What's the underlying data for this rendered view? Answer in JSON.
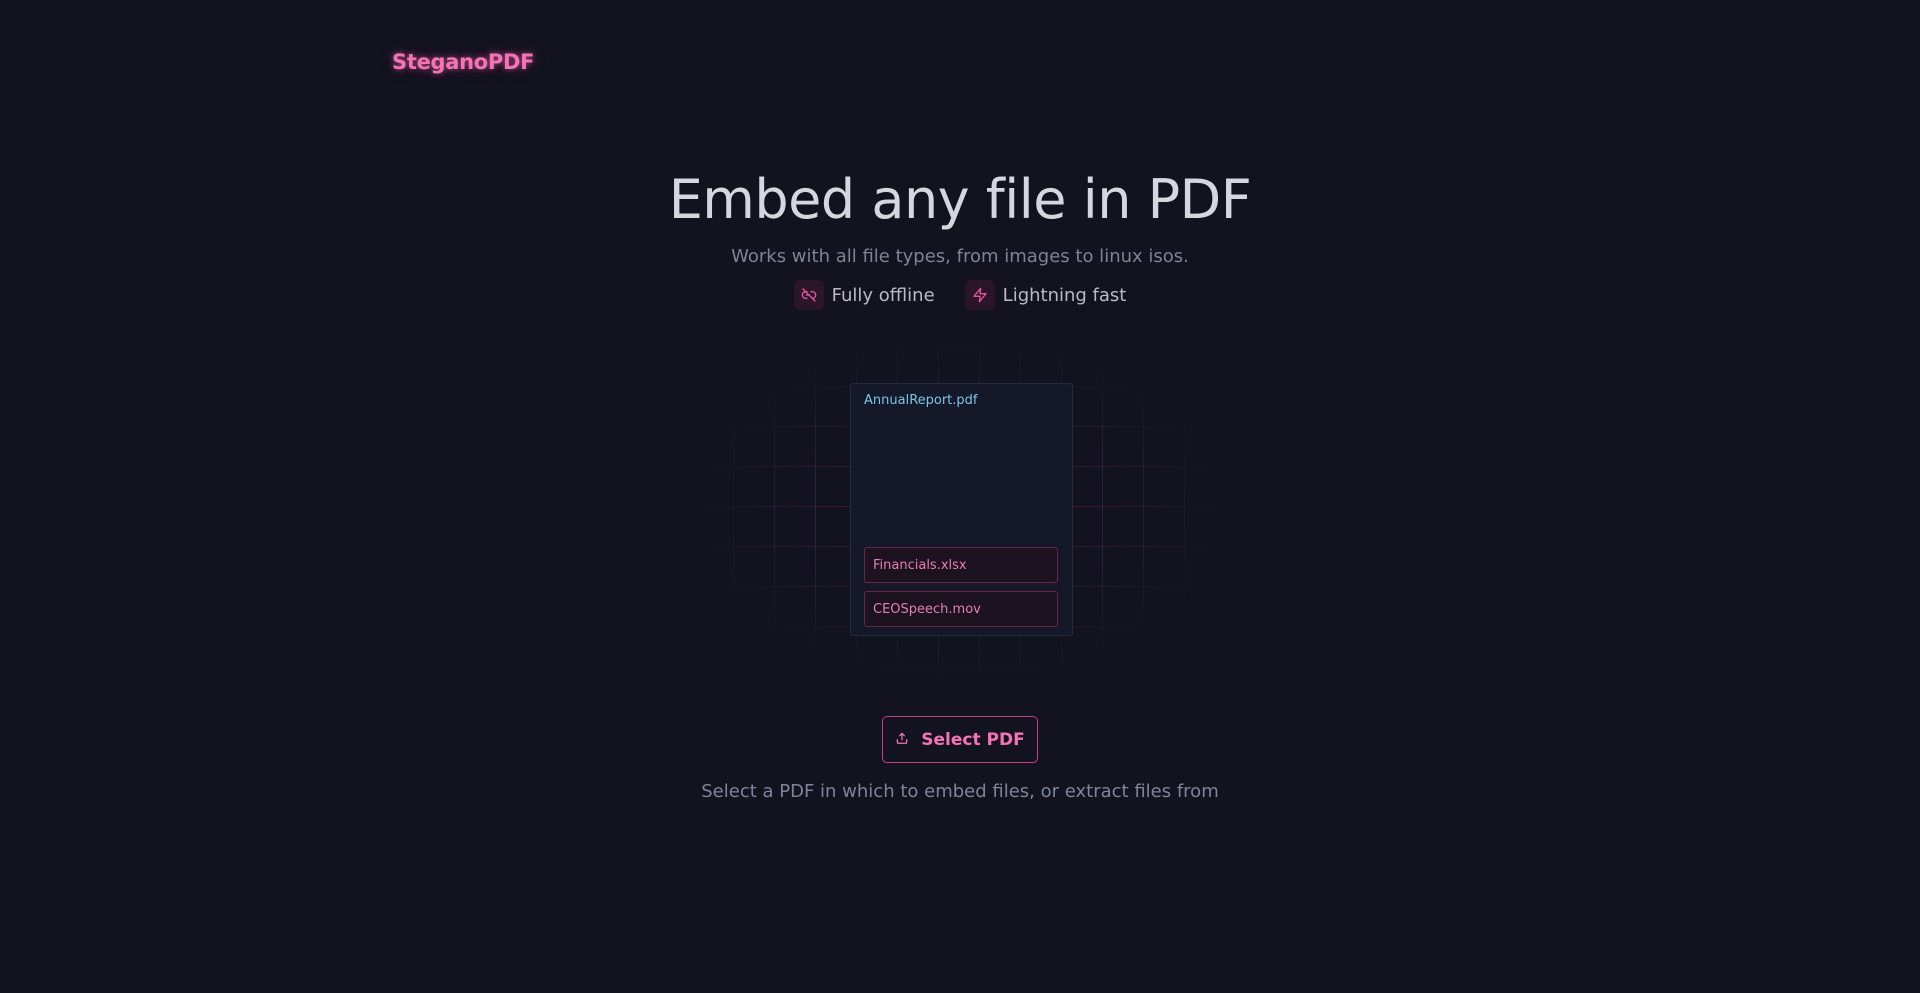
{
  "header": {
    "logo": "SteganoPDF"
  },
  "hero": {
    "title": "Embed any file in PDF",
    "subtitle": "Works with all file types, from images to linux isos."
  },
  "features": [
    {
      "icon": "link-off-icon",
      "label": "Fully offline"
    },
    {
      "icon": "lightning-icon",
      "label": "Lightning fast"
    }
  ],
  "illustration": {
    "pdf_name": "AnnualReport.pdf",
    "embedded_files": [
      "Financials.xlsx",
      "CEOSpeech.mov"
    ]
  },
  "actions": {
    "select_pdf_label": "Select PDF",
    "select_pdf_icon": "upload-icon",
    "helper_text": "Select a PDF in which to embed files, or extract files from"
  },
  "colors": {
    "background": "#12131f",
    "accent": "#f472b6",
    "pdf_name": "#7dc3e6"
  }
}
